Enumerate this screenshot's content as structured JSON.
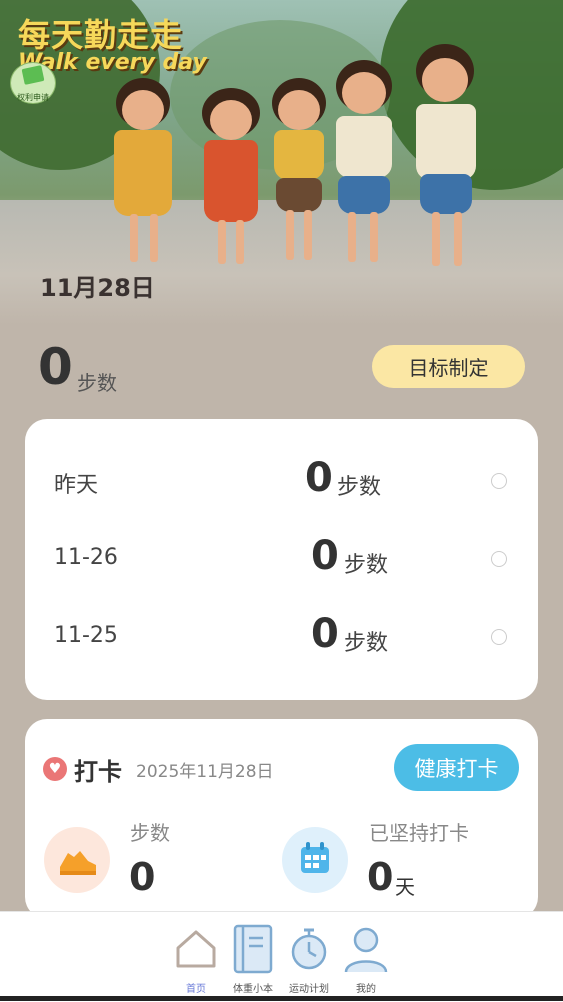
{
  "hero": {
    "title_cn": "每天勤走走",
    "title_en": "Walk every day",
    "badge_text": "权利申请",
    "date": "11月28日"
  },
  "summary": {
    "steps_value": "0",
    "steps_unit": "步数",
    "goal_button": "目标制定"
  },
  "history": [
    {
      "label": "昨天",
      "value": "0",
      "unit": "步数"
    },
    {
      "label": "11-26",
      "value": "0",
      "unit": "步数"
    },
    {
      "label": "11-25",
      "value": "0",
      "unit": "步数"
    }
  ],
  "checkin": {
    "heart_icon": "heart-icon",
    "title": "打卡",
    "date": "2025年11月28日",
    "button": "健康打卡",
    "steps_label": "步数",
    "steps_value": "0",
    "streak_label": "已坚持打卡",
    "streak_value": "0",
    "streak_unit": "天"
  },
  "nav": [
    {
      "label": "首页",
      "icon": "home-icon",
      "active": true
    },
    {
      "label": "体重小本",
      "icon": "notebook-icon",
      "active": false
    },
    {
      "label": "运动计划",
      "icon": "stopwatch-icon",
      "active": false
    },
    {
      "label": "我的",
      "icon": "person-icon",
      "active": false
    }
  ],
  "colors": {
    "background": "#bfb5aa",
    "goal_button": "#fbe7a4",
    "checkin_button": "#4cbde6",
    "heart": "#ea7676",
    "nav_active": "#6a7bd8"
  }
}
